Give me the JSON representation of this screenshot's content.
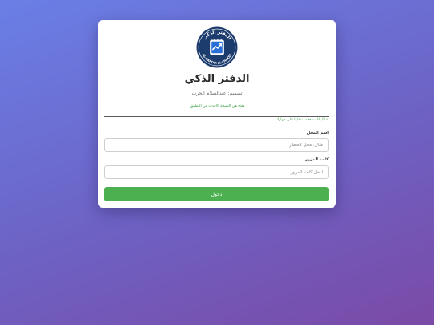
{
  "app": {
    "title": "الدفتر الذكي",
    "designer": "تصميم: عبدالسلام الحرب",
    "version_note": "هذه هي النسخة الأحدث من التطبيق",
    "saved_note": "✓ البيانات تحفظ تلقائيا على جهازك"
  },
  "logo": {
    "arc_text": "الدفتر الذكي",
    "latin_text": "AL-DAFTAR AL-THAKEE",
    "icon": "notebook-chart-icon"
  },
  "form": {
    "shop_label": "اسم المحل",
    "shop_placeholder": "مثال: محل الخضار",
    "shop_value": "",
    "password_label": "كلمة المرور",
    "password_placeholder": "أدخل كلمة المرور",
    "password_value": "",
    "login_label": "دخول"
  },
  "colors": {
    "accent": "#4caf50",
    "logo_navy": "#1d3c6e",
    "background_start": "#6a7fe6",
    "background_end": "#7b4aa6"
  }
}
